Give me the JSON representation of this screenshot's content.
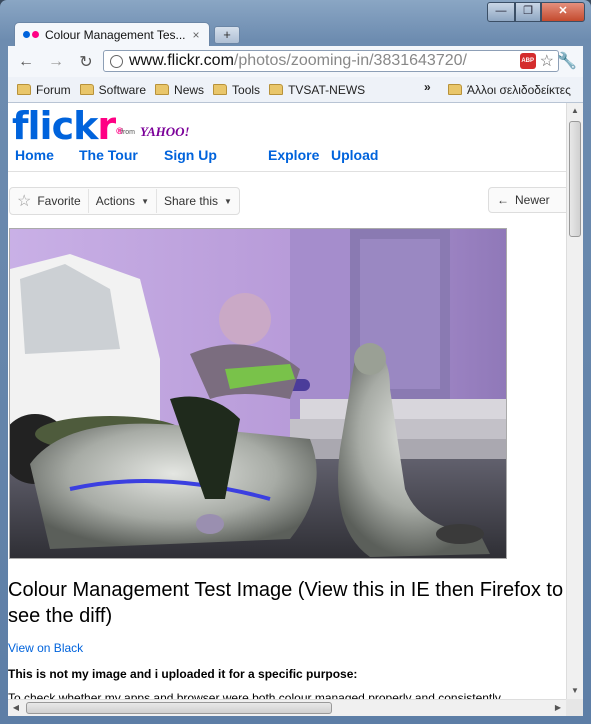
{
  "window": {
    "minimize_label": "—",
    "maximize_label": "❐",
    "close_label": "✕"
  },
  "tab": {
    "title": "Colour Management Tes...",
    "close": "×",
    "newtab": "+"
  },
  "toolbar": {
    "back": "←",
    "forward": "→",
    "reload": "↻",
    "url_host": "www.flickr.com",
    "url_path": "/photos/zooming-in/3831643720/",
    "abp": "ABP",
    "star": "☆",
    "wrench": "🔧"
  },
  "bookmarks": {
    "items": [
      "Forum",
      "Software",
      "News",
      "Tools",
      "TVSAT-NEWS"
    ],
    "chevron": "»",
    "other": "Άλλοι σελιδοδείκτες"
  },
  "flickr": {
    "logo_a": "flick",
    "logo_b": "r",
    "logo_reg": "®",
    "from": "from",
    "yahoo": "YAHOO!",
    "nav": [
      "Home",
      "The Tour",
      "Sign Up",
      "Explore",
      "Upload"
    ]
  },
  "actions": {
    "favorite": "Favorite",
    "actions": "Actions",
    "share": "Share this",
    "newer": "Newer"
  },
  "photo_page": {
    "title": "Colour Management Test Image (View this in IE then Firefox to see the diff)",
    "view_on_black": "View on Black",
    "bold_line": "This is not my image and i uploaded it for a specific purpose:",
    "desc": "To check whether my apps and browser were both colour managed properly and consistently"
  },
  "colors": {
    "flickr_blue": "#0063dc",
    "flickr_pink": "#ff0084",
    "tint": "#b89bd8"
  }
}
